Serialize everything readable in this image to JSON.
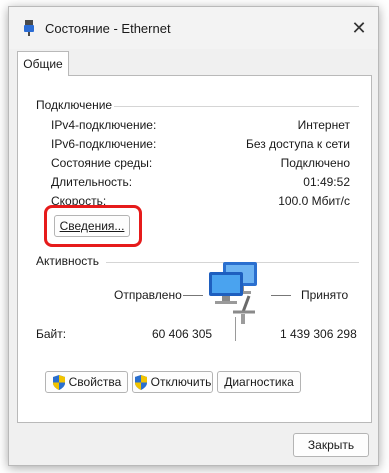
{
  "window": {
    "title": "Состояние - Ethernet",
    "close_glyph": "✕"
  },
  "tabs": [
    {
      "label": "Общие"
    }
  ],
  "connection": {
    "group_title": "Подключение",
    "rows": [
      {
        "label": "IPv4-подключение:",
        "value": "Интернет"
      },
      {
        "label": "IPv6-подключение:",
        "value": "Без доступа к сети"
      },
      {
        "label": "Состояние среды:",
        "value": "Подключено"
      },
      {
        "label": "Длительность:",
        "value": "01:49:52"
      },
      {
        "label": "Скорость:",
        "value": "100.0 Мбит/с"
      }
    ],
    "details_button": "Сведения..."
  },
  "activity": {
    "group_title": "Активность",
    "sent_label": "Отправлено",
    "received_label": "Принято",
    "bytes_label": "Байт:",
    "bytes_sent": "60 406 305",
    "bytes_received": "1 439 306 298"
  },
  "buttons": {
    "properties": "Свойства",
    "disable": "Отключить",
    "diagnose": "Диагностика",
    "close": "Закрыть"
  },
  "colors": {
    "highlight": "#e61b1b",
    "accent": "#2a6fcf"
  }
}
